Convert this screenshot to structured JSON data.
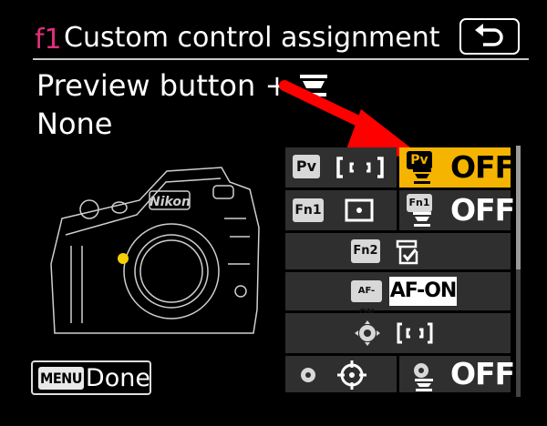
{
  "header": {
    "menu_code": "f1",
    "title": "Custom control assignment"
  },
  "item": {
    "label": "Preview button +",
    "label_icon": "sub-command-dial-icon",
    "value": "None"
  },
  "footer": {
    "menu_key": "MENU",
    "done_label": "Done"
  },
  "camera": {
    "brand": "Nikon"
  },
  "grid": {
    "rows": [
      {
        "control": "Pv",
        "cells": [
          "AF-area mode",
          "OFF"
        ]
      },
      {
        "control": "Fn1",
        "cells": [
          "Spot metering",
          "OFF"
        ]
      },
      {
        "control": "Fn2",
        "cells": [
          "My Menu"
        ]
      },
      {
        "control": "AF-ON",
        "cells": [
          "AF-ON"
        ]
      },
      {
        "control": "Sub-selector center",
        "cells": [
          "AF-area mode"
        ]
      },
      {
        "control": "Sub-selector",
        "cells": [
          "Focus point selection",
          "OFF"
        ]
      }
    ],
    "pv_label": "Pv",
    "fn1_label": "Fn1",
    "fn2_label": "Fn2",
    "afon_label": "AF-ON",
    "afon_value": "AF-ON",
    "pv_dial_value": "OFF",
    "fn1_dial_value": "OFF",
    "sub_dial_value": "OFF",
    "pv_dial_badge": "Pv",
    "fn1_dial_badge": "Fn1"
  },
  "colors": {
    "accent": "#e0307a",
    "highlight": "#f5b400",
    "arrow": "#ff0000"
  }
}
